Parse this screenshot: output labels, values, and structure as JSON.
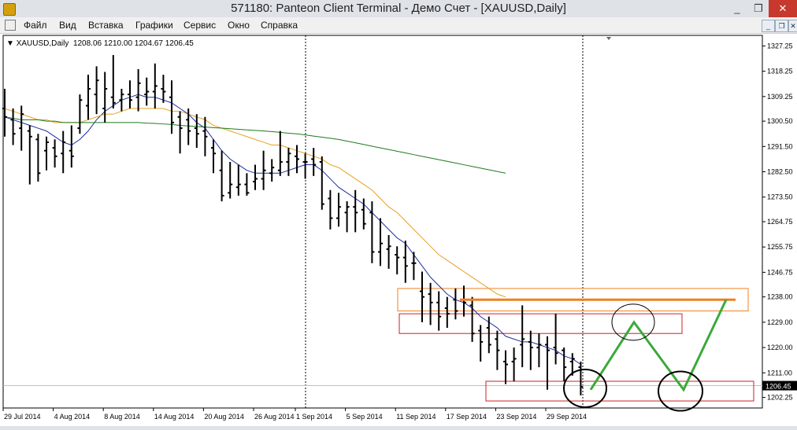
{
  "window": {
    "title": "571180: Panteon Client Terminal - Демо Счет - [XAUUSD,Daily]",
    "controls": {
      "minimize": "_",
      "restore": "❐",
      "close": "✕"
    }
  },
  "menu": [
    "Файл",
    "Вид",
    "Вставка",
    "Графики",
    "Сервис",
    "Окно",
    "Справка"
  ],
  "chart": {
    "symbol_label": "XAUUSD,Daily",
    "ohlc_label": "1208.06 1210.00 1204.67 1206.45",
    "current_price": "1206.45",
    "price_ticks": [
      "1327.25",
      "1318.25",
      "1309.25",
      "1300.50",
      "1291.50",
      "1282.50",
      "1273.50",
      "1264.75",
      "1255.75",
      "1246.75",
      "1238.00",
      "1229.00",
      "1220.00",
      "1211.00",
      "1202.25"
    ],
    "date_ticks": [
      "29 Jul 2014",
      "4 Aug 2014",
      "8 Aug 2014",
      "14 Aug 2014",
      "20 Aug 2014",
      "26 Aug 2014",
      "1 Sep 2014",
      "5 Sep 2014",
      "11 Sep 2014",
      "17 Sep 2014",
      "23 Sep 2014",
      "29 Sep 2014"
    ],
    "colors": {
      "bars": "#000000",
      "ma_fast": "#1f2f9f",
      "ma_mid": "#e8a020",
      "ma_slow": "#1e7a1e",
      "zones": "#cc2222",
      "resistance": "#f08020",
      "projection": "#3aaa3a",
      "circles": "#000000"
    }
  },
  "chart_data": {
    "type": "ohlc",
    "symbol": "XAUUSD",
    "timeframe": "Daily",
    "ylim": [
      1198.5,
      1331
    ],
    "bars": [
      {
        "o": 1305,
        "h": 1312,
        "l": 1295,
        "c": 1302
      },
      {
        "o": 1301,
        "h": 1305,
        "l": 1292,
        "c": 1296
      },
      {
        "o": 1298,
        "h": 1306,
        "l": 1290,
        "c": 1303
      },
      {
        "o": 1297,
        "h": 1299,
        "l": 1278,
        "c": 1295
      },
      {
        "o": 1294,
        "h": 1296,
        "l": 1279,
        "c": 1282
      },
      {
        "o": 1290,
        "h": 1295,
        "l": 1283,
        "c": 1293
      },
      {
        "o": 1291,
        "h": 1294,
        "l": 1284,
        "c": 1288
      },
      {
        "o": 1289,
        "h": 1297,
        "l": 1282,
        "c": 1293
      },
      {
        "o": 1290,
        "h": 1299,
        "l": 1284,
        "c": 1288
      },
      {
        "o": 1298,
        "h": 1310,
        "l": 1296,
        "c": 1308
      },
      {
        "o": 1306,
        "h": 1317,
        "l": 1301,
        "c": 1312
      },
      {
        "o": 1310,
        "h": 1320,
        "l": 1303,
        "c": 1315
      },
      {
        "o": 1305,
        "h": 1318,
        "l": 1300,
        "c": 1312
      },
      {
        "o": 1309,
        "h": 1324,
        "l": 1305,
        "c": 1307
      },
      {
        "o": 1308,
        "h": 1312,
        "l": 1304,
        "c": 1310
      },
      {
        "o": 1310,
        "h": 1315,
        "l": 1305,
        "c": 1308
      },
      {
        "o": 1309,
        "h": 1319,
        "l": 1304,
        "c": 1314
      },
      {
        "o": 1310,
        "h": 1316,
        "l": 1306,
        "c": 1311
      },
      {
        "o": 1311,
        "h": 1321,
        "l": 1305,
        "c": 1313
      },
      {
        "o": 1312,
        "h": 1317,
        "l": 1307,
        "c": 1311
      },
      {
        "o": 1309,
        "h": 1315,
        "l": 1296,
        "c": 1300
      },
      {
        "o": 1302,
        "h": 1304,
        "l": 1289,
        "c": 1298
      },
      {
        "o": 1301,
        "h": 1305,
        "l": 1292,
        "c": 1297
      },
      {
        "o": 1298,
        "h": 1303,
        "l": 1291,
        "c": 1296
      },
      {
        "o": 1297,
        "h": 1302,
        "l": 1288,
        "c": 1295
      },
      {
        "o": 1291,
        "h": 1294,
        "l": 1282,
        "c": 1289
      },
      {
        "o": 1283,
        "h": 1290,
        "l": 1272,
        "c": 1274
      },
      {
        "o": 1275,
        "h": 1286,
        "l": 1273,
        "c": 1278
      },
      {
        "o": 1277,
        "h": 1285,
        "l": 1274,
        "c": 1278
      },
      {
        "o": 1278,
        "h": 1282,
        "l": 1274,
        "c": 1275
      },
      {
        "o": 1279,
        "h": 1285,
        "l": 1276,
        "c": 1280
      },
      {
        "o": 1280,
        "h": 1290,
        "l": 1276,
        "c": 1283
      },
      {
        "o": 1282,
        "h": 1287,
        "l": 1279,
        "c": 1284
      },
      {
        "o": 1283,
        "h": 1297,
        "l": 1281,
        "c": 1286
      },
      {
        "o": 1286,
        "h": 1291,
        "l": 1281,
        "c": 1289
      },
      {
        "o": 1288,
        "h": 1292,
        "l": 1282,
        "c": 1287
      },
      {
        "o": 1286,
        "h": 1289,
        "l": 1280,
        "c": 1286
      },
      {
        "o": 1287,
        "h": 1291,
        "l": 1281,
        "c": 1285
      },
      {
        "o": 1286,
        "h": 1288,
        "l": 1269,
        "c": 1271
      },
      {
        "o": 1273,
        "h": 1276,
        "l": 1262,
        "c": 1266
      },
      {
        "o": 1266,
        "h": 1275,
        "l": 1263,
        "c": 1270
      },
      {
        "o": 1268,
        "h": 1272,
        "l": 1261,
        "c": 1270
      },
      {
        "o": 1270,
        "h": 1276,
        "l": 1261,
        "c": 1268
      },
      {
        "o": 1269,
        "h": 1273,
        "l": 1262,
        "c": 1264
      },
      {
        "o": 1268,
        "h": 1272,
        "l": 1250,
        "c": 1254
      },
      {
        "o": 1254,
        "h": 1266,
        "l": 1249,
        "c": 1257
      },
      {
        "o": 1255,
        "h": 1260,
        "l": 1248,
        "c": 1256
      },
      {
        "o": 1253,
        "h": 1256,
        "l": 1246,
        "c": 1252
      },
      {
        "o": 1252,
        "h": 1258,
        "l": 1243,
        "c": 1249
      },
      {
        "o": 1250,
        "h": 1254,
        "l": 1244,
        "c": 1250
      },
      {
        "o": 1240,
        "h": 1247,
        "l": 1229,
        "c": 1238
      },
      {
        "o": 1239,
        "h": 1243,
        "l": 1228,
        "c": 1236
      },
      {
        "o": 1236,
        "h": 1240,
        "l": 1226,
        "c": 1231
      },
      {
        "o": 1234,
        "h": 1238,
        "l": 1227,
        "c": 1232
      },
      {
        "o": 1237,
        "h": 1241,
        "l": 1230,
        "c": 1233
      },
      {
        "o": 1237,
        "h": 1242,
        "l": 1231,
        "c": 1236
      },
      {
        "o": 1235,
        "h": 1238,
        "l": 1222,
        "c": 1225
      },
      {
        "o": 1226,
        "h": 1228,
        "l": 1215,
        "c": 1222
      },
      {
        "o": 1227,
        "h": 1231,
        "l": 1218,
        "c": 1221
      },
      {
        "o": 1223,
        "h": 1226,
        "l": 1212,
        "c": 1219
      },
      {
        "o": 1215,
        "h": 1219,
        "l": 1207,
        "c": 1214
      },
      {
        "o": 1215,
        "h": 1220,
        "l": 1208,
        "c": 1216
      },
      {
        "o": 1221,
        "h": 1235,
        "l": 1213,
        "c": 1223
      },
      {
        "o": 1222,
        "h": 1226,
        "l": 1212,
        "c": 1220
      },
      {
        "o": 1220,
        "h": 1225,
        "l": 1213,
        "c": 1221
      },
      {
        "o": 1221,
        "h": 1224,
        "l": 1205,
        "c": 1219
      },
      {
        "o": 1220,
        "h": 1232,
        "l": 1214,
        "c": 1218
      },
      {
        "o": 1219,
        "h": 1220,
        "l": 1208,
        "c": 1213
      },
      {
        "o": 1215,
        "h": 1218,
        "l": 1210,
        "c": 1216
      },
      {
        "o": 1213,
        "h": 1215,
        "l": 1203,
        "c": 1206
      }
    ],
    "indicators": [
      {
        "name": "MA fast",
        "values": [
          1302,
          1301,
          1300,
          1299,
          1298,
          1297,
          1295,
          1293,
          1292,
          1294,
          1297,
          1301,
          1304,
          1306,
          1308,
          1309,
          1310,
          1309,
          1309,
          1308,
          1307,
          1305,
          1303,
          1300,
          1298,
          1294,
          1290,
          1287,
          1285,
          1283,
          1282,
          1282,
          1282,
          1282,
          1283,
          1284,
          1285,
          1285,
          1283,
          1280,
          1277,
          1275,
          1273,
          1271,
          1268,
          1265,
          1262,
          1259,
          1257,
          1253,
          1249,
          1245,
          1242,
          1239,
          1237,
          1236,
          1234,
          1231,
          1229,
          1227,
          1224,
          1223,
          1222,
          1222,
          1221,
          1220,
          1219,
          1217,
          1216,
          1214
        ]
      },
      {
        "name": "MA mid",
        "values": [
          1305,
          1304,
          1303,
          1302,
          1301,
          1301,
          1300,
          1300,
          1300,
          1300,
          1301,
          1302,
          1303,
          1303,
          1304,
          1305,
          1305,
          1305,
          1305,
          1305,
          1304,
          1304,
          1303,
          1302,
          1301,
          1299,
          1298,
          1297,
          1296,
          1295,
          1294,
          1293,
          1292,
          1292,
          1291,
          1290,
          1289,
          1288,
          1287,
          1285,
          1284,
          1282,
          1280,
          1278,
          1276,
          1273,
          1270,
          1268,
          1265,
          1262,
          1259,
          1256,
          1253,
          1251,
          1249,
          1247,
          1245,
          1243,
          1241,
          1239,
          1238
        ]
      },
      {
        "name": "MA slow",
        "values": [
          1302,
          1301.5,
          1301,
          1301,
          1301,
          1300.5,
          1300.5,
          1300,
          1300,
          1300,
          1300,
          1300,
          1300,
          1300,
          1300,
          1300,
          1300,
          1299.8,
          1299.7,
          1299.5,
          1299.3,
          1299,
          1298.8,
          1298.6,
          1298.4,
          1298.2,
          1298,
          1297.8,
          1297.6,
          1297.4,
          1297.2,
          1297,
          1296.8,
          1296.5,
          1296.2,
          1296,
          1295.6,
          1295.2,
          1294.8,
          1294.4,
          1294,
          1293.4,
          1292.8,
          1292.2,
          1291.6,
          1291,
          1290.4,
          1289.8,
          1289.2,
          1288.6,
          1288,
          1287.4,
          1286.8,
          1286.2,
          1285.6,
          1285,
          1284.4,
          1283.8,
          1283.2,
          1282.6,
          1282
        ]
      }
    ],
    "annotations": {
      "resistance_price": 1237,
      "zones": [
        {
          "from_bar": 64,
          "price_top": 1241,
          "price_bottom": 1233,
          "color": "orange"
        },
        {
          "from_bar": 64,
          "price_top": 1232,
          "price_bottom": 1225,
          "color": "red"
        },
        {
          "from_bar": 78,
          "price_top": 1208,
          "price_bottom": 1201,
          "color": "red"
        }
      ],
      "projection": [
        [
          1205
        ],
        [
          1229
        ],
        [
          1205
        ],
        [
          1237
        ]
      ]
    }
  }
}
